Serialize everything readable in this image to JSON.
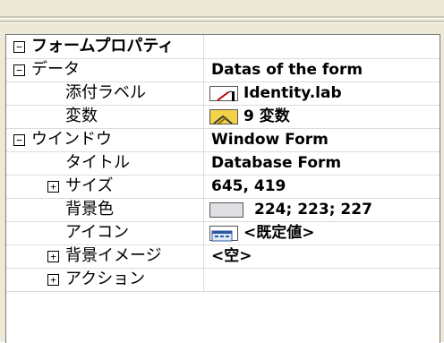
{
  "panel": {
    "rows": [
      {
        "name": "フォームプロパティ",
        "value": "",
        "expander": "−",
        "level": 0,
        "category": true
      },
      {
        "name": "データ",
        "value": "Datas of the form",
        "expander": "−",
        "level": 0,
        "category": false
      },
      {
        "name": "添付ラベル",
        "value": "Identity.lab",
        "expander": "",
        "level": 1,
        "icon": "label-icon"
      },
      {
        "name": "変数",
        "value": "9 変数",
        "expander": "",
        "level": 1,
        "icon": "variables-icon"
      },
      {
        "name": "ウインドウ",
        "value": "Window Form",
        "expander": "−",
        "level": 0
      },
      {
        "name": "タイトル",
        "value": "Database Form",
        "expander": "",
        "level": 1
      },
      {
        "name": "サイズ",
        "value": "645, 419",
        "expander": "+",
        "level": 1
      },
      {
        "name": "背景色",
        "value": "224; 223; 227",
        "expander": "",
        "level": 1,
        "icon": "color-swatch-icon"
      },
      {
        "name": "アイコン",
        "value": "<既定値>",
        "expander": "",
        "level": 1,
        "icon": "window-icon"
      },
      {
        "name": "背景イメージ",
        "value": "<空>",
        "expander": "+",
        "level": 1
      },
      {
        "name": "アクション",
        "value": "",
        "expander": "+",
        "level": 1
      }
    ]
  },
  "colors": {
    "swatch": "#e0dfe3",
    "border": "#7a7a7a",
    "frame": "#ece9d8"
  }
}
